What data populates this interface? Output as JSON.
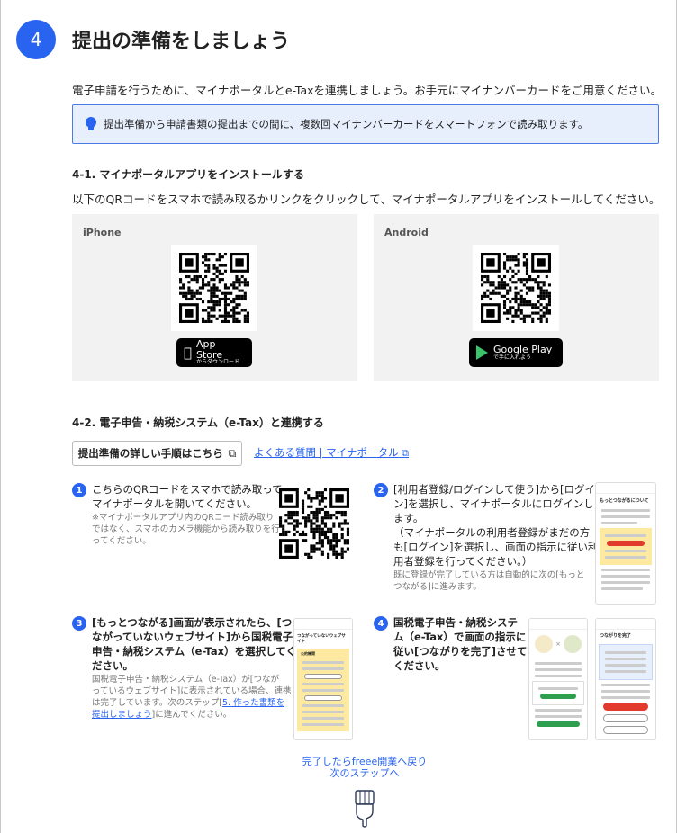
{
  "step": {
    "number": "4",
    "title": "提出の準備をしましょう"
  },
  "intro": "電子申請を行うために、マイナポータルとe-Taxを連携しましょう。お手元にマイナンバーカードをご用意ください。",
  "note": {
    "icon": "lightbulb-icon",
    "text": "提出準備から申請書類の提出までの間に、複数回マイナンバーカードをスマートフォンで読み取ります。"
  },
  "section1": {
    "heading": "4-1. マイナポータルアプリをインストールする",
    "description": "以下のQRコードをスマホで読み取るかリンクをクリックして、マイナポータルアプリをインストールしてください。",
    "iphone": {
      "label": "iPhone",
      "store_main": "App Store",
      "store_sub": "からダウンロード",
      "icon": "apple-icon"
    },
    "android": {
      "label": "Android",
      "store_main": "Google Play",
      "store_sub": "で手に入れよう",
      "icon": "google-play-icon"
    }
  },
  "section2": {
    "heading": "4-2. 電子申告・納税システム（e-Tax）と連携する",
    "detail_button": "提出準備の詳しい手順はこちら",
    "faq_link": "よくある質問 | マイナポータル",
    "steps": [
      {
        "num": "1",
        "main": [
          "こちらのQRコードをスマホで読み取って",
          "マイナポータルを開いてください。"
        ],
        "sub": [
          "※マイナポータルアプリ内のQRコード読み取り",
          "ではなく、スマホのカメラ機能から読み取りを行",
          "ってください。"
        ]
      },
      {
        "num": "2",
        "main": [
          "[利用者登録/ログインして使う]から[ログイ",
          "ン]を選択し、マイナポータルにログインし",
          "ます。",
          "（マイナポータルの利用者登録がまだの方",
          "も[ログイン]を選択し、画面の指示に従い利",
          "用者登録を行ってください。）"
        ],
        "sub": [
          "既に登録が完了している方は自動的に次の[もっと",
          "つながる]に進みます。"
        ]
      },
      {
        "num": "3",
        "main": [
          "[もっとつながる]画面が表示されたら、[つ",
          "ながっていないウェブサイト]から国税電子",
          "申告・納税システム（e-Tax）を選択してく",
          "ださい。"
        ],
        "sub": [
          "国税電子申告・納税システム（e-Tax）が[つなが",
          "っているウェブサイト]に表示されている場合、連携",
          "は完了しています。次のステップ[",
          "5. 作った書類を",
          "提出しましょう",
          "]に進んでください。"
        ]
      },
      {
        "num": "4",
        "main": [
          "国税電子申告・納税システ",
          "ム（e-Tax）で画面の指示に",
          "従い[つながりを完了]させて",
          "ください。"
        ]
      }
    ],
    "phone_title_2": "もっとつながるについて",
    "phone_title_3": "つながっていないウェブサイト",
    "phone_section_3": "公的機関",
    "phone_title_4": "つながりを完了"
  },
  "next": {
    "line1": "完了したらfreee開業へ戻り",
    "line2": "次のステップへ"
  },
  "colors": {
    "accent": "#2864f0",
    "note_bg": "#e7effd",
    "box_bg": "#f2f2f2"
  }
}
